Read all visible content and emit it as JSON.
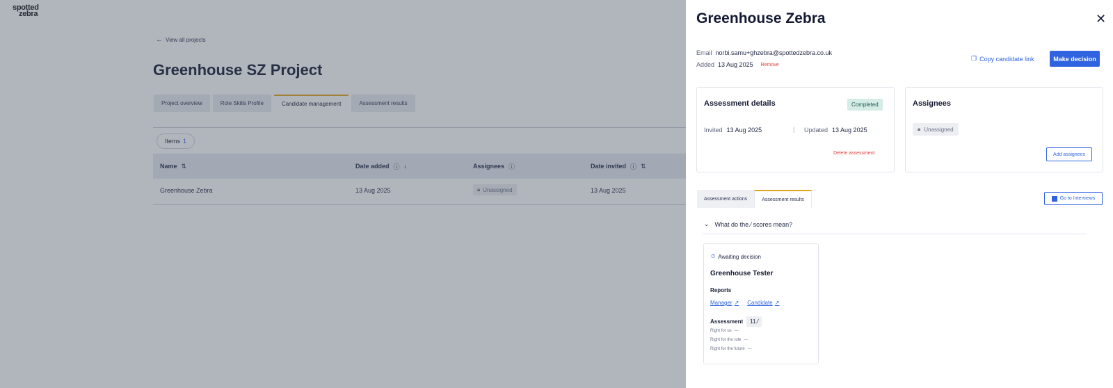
{
  "logo": {
    "line1": "spotted",
    "line2": "zebra"
  },
  "background": {
    "back_link": "View all projects",
    "page_title": "Greenhouse SZ Project",
    "tabs": [
      {
        "label": "Project overview"
      },
      {
        "label": "Role Skills Profile"
      },
      {
        "label": "Candidate management"
      },
      {
        "label": "Assessment results"
      }
    ],
    "active_tab": "Candidate management",
    "items_label": "Items",
    "items_count": "1",
    "table": {
      "headers": [
        "Name",
        "Date added",
        "Assignees",
        "Date invited"
      ],
      "rows": [
        {
          "name": "Greenhouse Zebra",
          "date_added": "13 Aug 2025",
          "assignees": "Unassigned",
          "date_invited": "13 Aug 2025"
        }
      ]
    }
  },
  "drawer": {
    "title": "Greenhouse Zebra",
    "email_label": "Email",
    "email": "norbi.samu+ghzebra@spottedzebra.co.uk",
    "added_label": "Added",
    "added": "13 Aug 2025",
    "remove_label": "Remove",
    "copy_link_label": "Copy candidate link",
    "make_decision_label": "Make decision",
    "assessment_details": {
      "title": "Assessment details",
      "status": "Completed",
      "invited_label": "Invited",
      "invited": "13 Aug 2025",
      "updated_label": "Updated",
      "updated": "13 Aug 2025",
      "delete_label": "Delete assessment"
    },
    "assignees": {
      "title": "Assignees",
      "value": "Unassigned",
      "add_label": "Add assignees"
    },
    "sub_tabs": [
      {
        "label": "Assessment actions"
      },
      {
        "label": "Assessment results"
      }
    ],
    "go_interviews_label": "Go to Interviews",
    "faq_label": "What do the ⁄ scores mean?",
    "result_card": {
      "status": "Awaiting decision",
      "name": "Greenhouse Tester",
      "reports_label": "Reports",
      "manager_link": "Manager",
      "candidate_link": "Candidate",
      "assessment_label": "Assessment",
      "assessment_score": "11 ⁄",
      "rows": [
        {
          "label": "Right for us",
          "value": "—"
        },
        {
          "label": "Right for the role",
          "value": "—"
        },
        {
          "label": "Right for the future",
          "value": "—"
        }
      ]
    }
  },
  "colors": {
    "accent": "#2f63e0",
    "tab_highlight": "#e0a51c",
    "danger": "#e23b3b",
    "completed_bg": "#d5ece6"
  }
}
